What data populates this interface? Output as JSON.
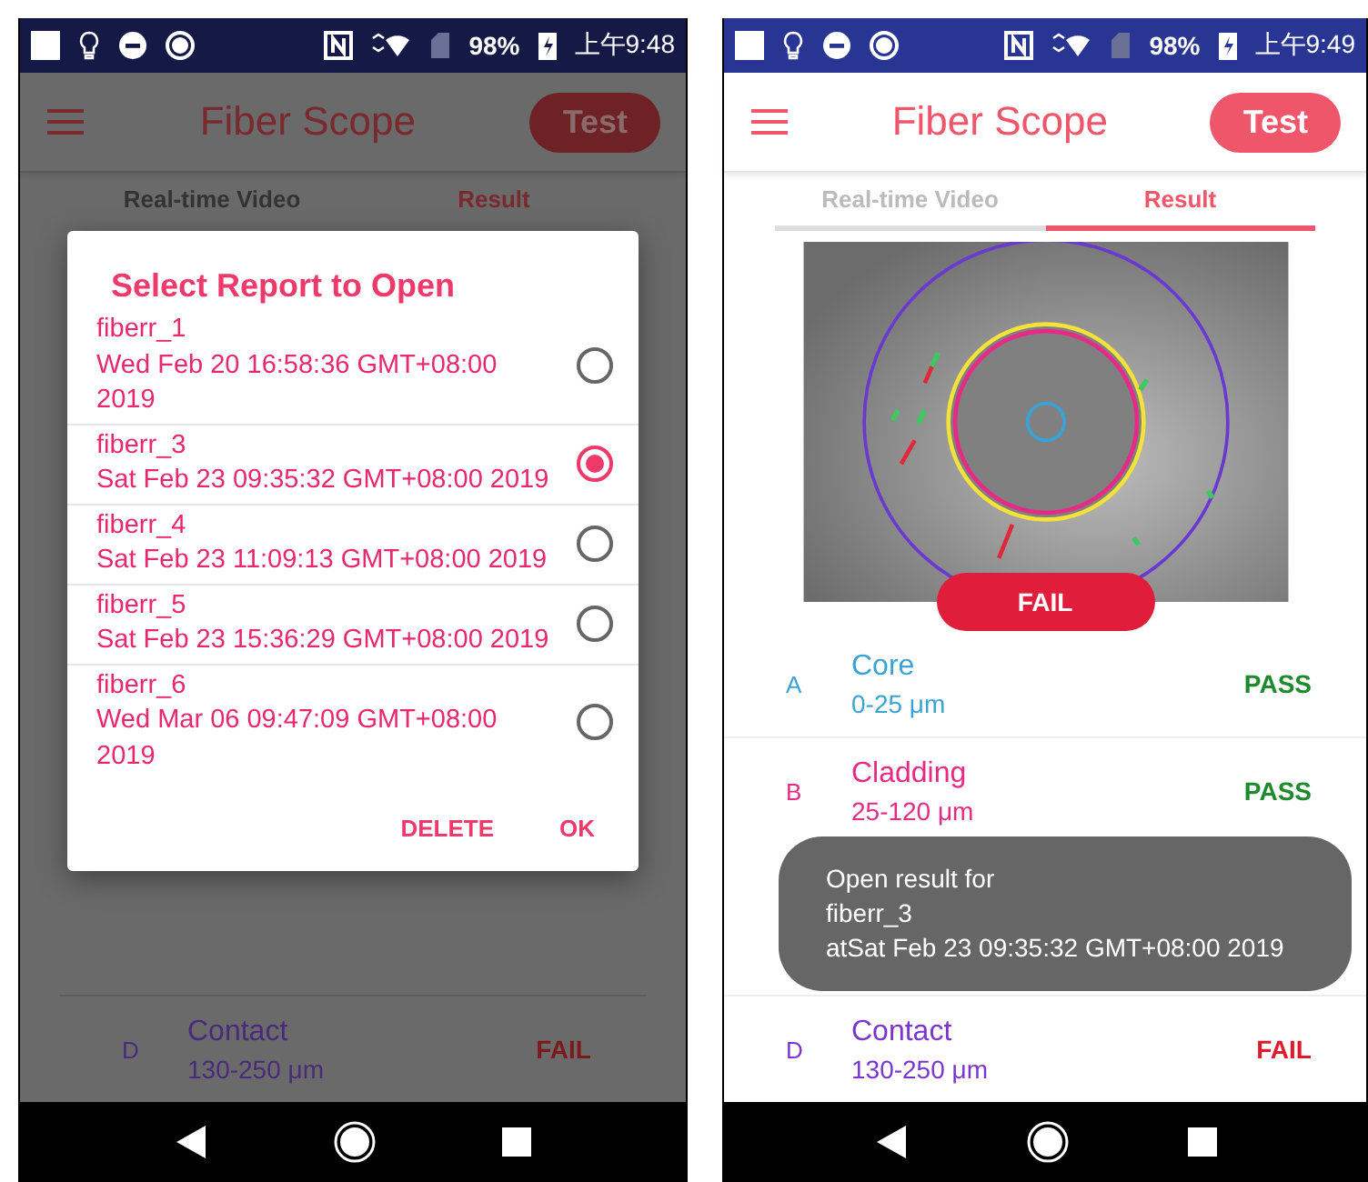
{
  "phones": [
    {
      "dimmed": true,
      "status_bar": {
        "battery": "98%",
        "time": "上午9:48"
      },
      "app_bar": {
        "title": "Fiber Scope",
        "action": "Test"
      },
      "tabs": [
        {
          "label": "Real-time Video",
          "selected": false
        },
        {
          "label": "Result",
          "selected": true
        }
      ],
      "dialog": {
        "title": "Select Report to Open",
        "reports": [
          {
            "name": "fiberr_1",
            "date": "Wed Feb 20 16:58:36 GMT+08:00 2019",
            "selected": false
          },
          {
            "name": "fiberr_3",
            "date": "Sat Feb 23 09:35:32 GMT+08:00 2019",
            "selected": true
          },
          {
            "name": "fiberr_4",
            "date": "Sat Feb 23 11:09:13 GMT+08:00 2019",
            "selected": false
          },
          {
            "name": "fiberr_5",
            "date": "Sat Feb 23 15:36:29 GMT+08:00 2019",
            "selected": false
          },
          {
            "name": "fiberr_6",
            "date": "Wed Mar 06 09:47:09 GMT+08:00 2019",
            "selected": false
          }
        ],
        "buttons": [
          "DELETE",
          "OK"
        ]
      },
      "zones": [
        {
          "letter": "D",
          "name": "Contact",
          "range": "130-250 μm",
          "status": "FAIL",
          "passed": false,
          "color": "#4a2a7a"
        }
      ]
    },
    {
      "dimmed": false,
      "status_bar": {
        "battery": "98%",
        "time": "上午9:49"
      },
      "app_bar": {
        "title": "Fiber Scope",
        "action": "Test"
      },
      "tabs": [
        {
          "label": "Real-time Video",
          "selected": false
        },
        {
          "label": "Result",
          "selected": true
        }
      ],
      "overall": {
        "status": "FAIL",
        "passed": false
      },
      "zones": [
        {
          "letter": "A",
          "name": "Core",
          "range": "0-25 μm",
          "status": "PASS",
          "passed": true,
          "color": "#3aa3d6"
        },
        {
          "letter": "B",
          "name": "Cladding",
          "range": "25-120 μm",
          "status": "PASS",
          "passed": true,
          "color": "#e62a86"
        },
        {
          "letter": "D",
          "name": "Contact",
          "range": "130-250 μm",
          "status": "FAIL",
          "passed": false,
          "color": "#7a35d0"
        }
      ],
      "toast": {
        "lines": [
          "Open result for",
          "fiberr_3",
          "atSat Feb 23 09:35:32 GMT+08:00 2019"
        ]
      }
    }
  ]
}
